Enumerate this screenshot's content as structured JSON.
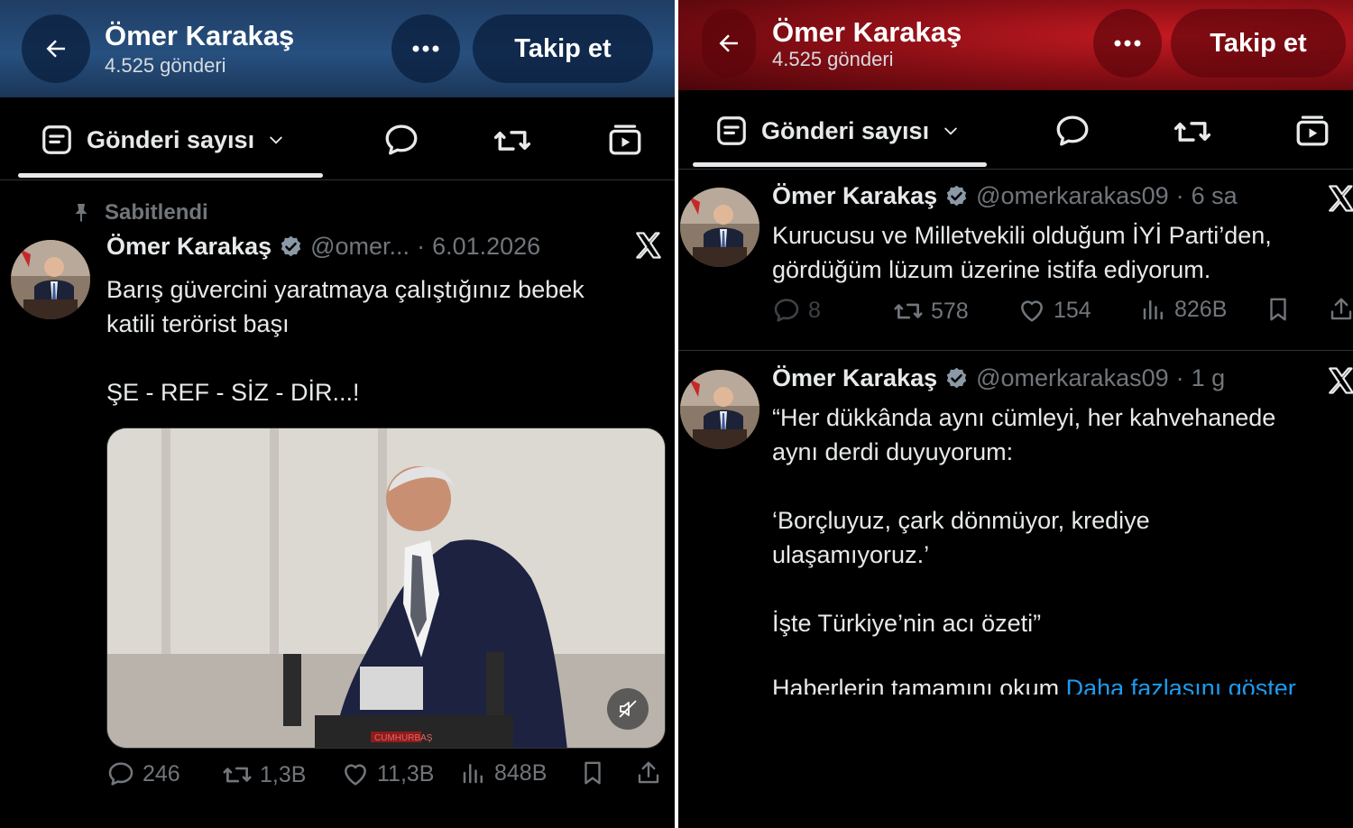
{
  "left": {
    "header": {
      "name": "Ömer Karakaş",
      "subtitle": "4.525 gönderi",
      "follow_label": "Takip et",
      "back_icon": "arrow-left-icon",
      "more_icon": "more-dots-icon"
    },
    "tabs": {
      "count_label": "Gönderi sayısı"
    },
    "pinned_label": "Sabitlendi",
    "tweet": {
      "name": "Ömer Karakaş",
      "handle": "@omer...",
      "dot": "·",
      "time": "6.01.2026",
      "body": "Barış güvercini yaratmaya çalıştığınız bebek\nkatili terörist başı\n\nŞE - REF - SİZ - DİR...!",
      "media_badge": "CUMHURBAŞ",
      "actions": {
        "replies": "246",
        "reposts": "1,3B",
        "likes": "11,3B",
        "views": "848B"
      }
    }
  },
  "right": {
    "header": {
      "name": "Ömer Karakaş",
      "subtitle": "4.525 gönderi",
      "follow_label": "Takip et"
    },
    "tabs": {
      "count_label": "Gönderi sayısı"
    },
    "tweets": [
      {
        "name": "Ömer Karakaş",
        "handle": "@omerkarakas09",
        "dot": "·",
        "time": "6 sa",
        "body": "Kurucusu ve Milletvekili olduğum İYİ Parti’den,\ngördüğüm lüzum üzerine istifa ediyorum.",
        "actions": {
          "replies": "8",
          "reposts": "578",
          "likes": "154",
          "views": "826B"
        }
      },
      {
        "name": "Ömer Karakaş",
        "handle": "@omerkarakas09",
        "dot": "·",
        "time": "1 g",
        "body": "“Her dükkânda aynı cümleyi, her kahvehanede\naynı derdi duyuyorum:\n\n‘Borçluyuz, çark dönmüyor, krediye\nulaşamıyoruz.’\n\nİşte Türkiye’nin acı özeti”",
        "last_line": "Haberlerin tamamını okum",
        "show_more": "Daha fazlasını göster"
      }
    ]
  },
  "colors": {
    "left_header": "#27507f",
    "right_header": "#c41a22",
    "verified": "#1d9bf0",
    "muted": "#71767b",
    "link": "#1d9bf0"
  }
}
